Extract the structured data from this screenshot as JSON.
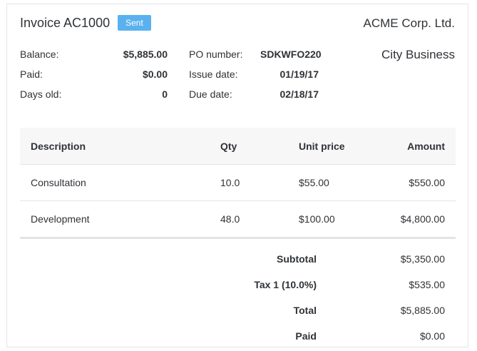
{
  "invoice": {
    "title": "Invoice AC1000",
    "status": "Sent",
    "status_color": "#5ab1ef",
    "company": "ACME Corp. Ltd.",
    "branch": "City Business"
  },
  "meta_left": [
    {
      "label": "Balance:",
      "value": "$5,885.00"
    },
    {
      "label": "Paid:",
      "value": "$0.00"
    },
    {
      "label": "Days old:",
      "value": "0"
    }
  ],
  "meta_right": [
    {
      "label": "PO number:",
      "value": "SDKWFO220"
    },
    {
      "label": "Issue date:",
      "value": "01/19/17"
    },
    {
      "label": "Due date:",
      "value": "02/18/17"
    }
  ],
  "table": {
    "headers": {
      "description": "Description",
      "qty": "Qty",
      "unit_price": "Unit price",
      "amount": "Amount"
    },
    "rows": [
      {
        "description": "Consultation",
        "qty": "10.0",
        "unit_price": "$55.00",
        "amount": "$550.00"
      },
      {
        "description": "Development",
        "qty": "48.0",
        "unit_price": "$100.00",
        "amount": "$4,800.00"
      }
    ]
  },
  "totals": [
    {
      "label": "Subtotal",
      "value": "$5,350.00"
    },
    {
      "label": "Tax 1 (10.0%)",
      "value": "$535.00"
    },
    {
      "label": "Total",
      "value": "$5,885.00"
    },
    {
      "label": "Paid",
      "value": "$0.00"
    }
  ]
}
